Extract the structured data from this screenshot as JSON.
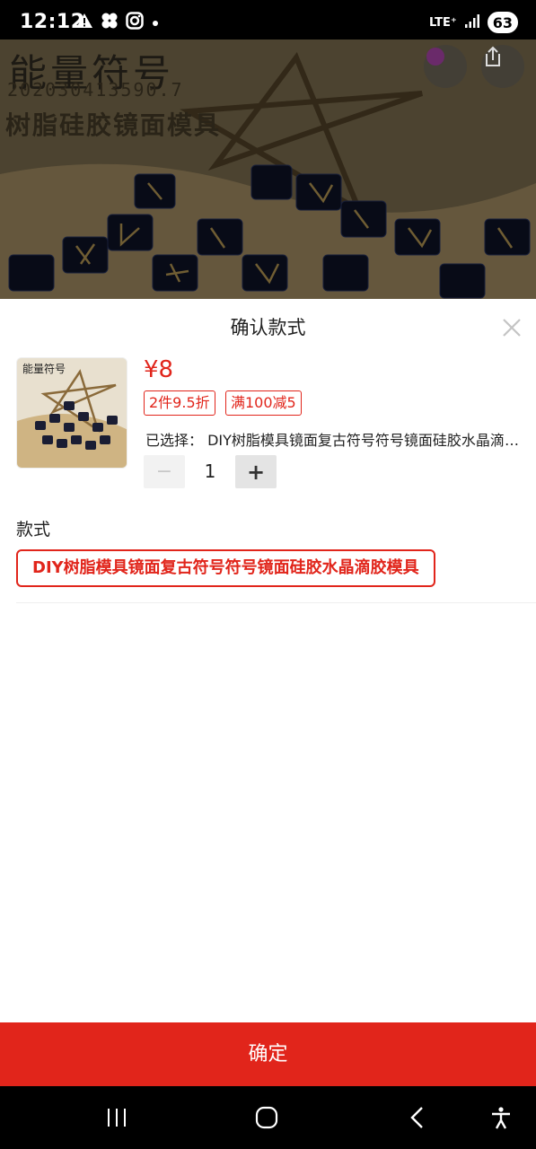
{
  "status_bar": {
    "time": "12:12",
    "network": "LTE⁺",
    "battery": "63",
    "icons": [
      "warning-icon",
      "app-cluster-icon",
      "instagram-icon",
      "dot-icon",
      "signal-icon",
      "battery-icon"
    ]
  },
  "background_image": {
    "title": "能量符号",
    "code": "20203041359​0.7",
    "subtitle": "树脂硅胶镜面模具"
  },
  "sheet": {
    "title": "确认款式",
    "price": "¥8",
    "tags": [
      "2件9.5折",
      "满100减5"
    ],
    "selected_prefix": "已选择：",
    "selected_value": "DIY树脂模具镜面复古符号符号镜面硅胶水晶滴胶模具",
    "quantity": "1",
    "minus_label": "−",
    "plus_label": "+",
    "section_label": "款式",
    "option": "DIY树脂模具镜面复古符号符号镜面硅胶水晶滴胶模具"
  },
  "confirm_label": "确定",
  "colors": {
    "accent": "#e1251b",
    "text": "#222222"
  }
}
